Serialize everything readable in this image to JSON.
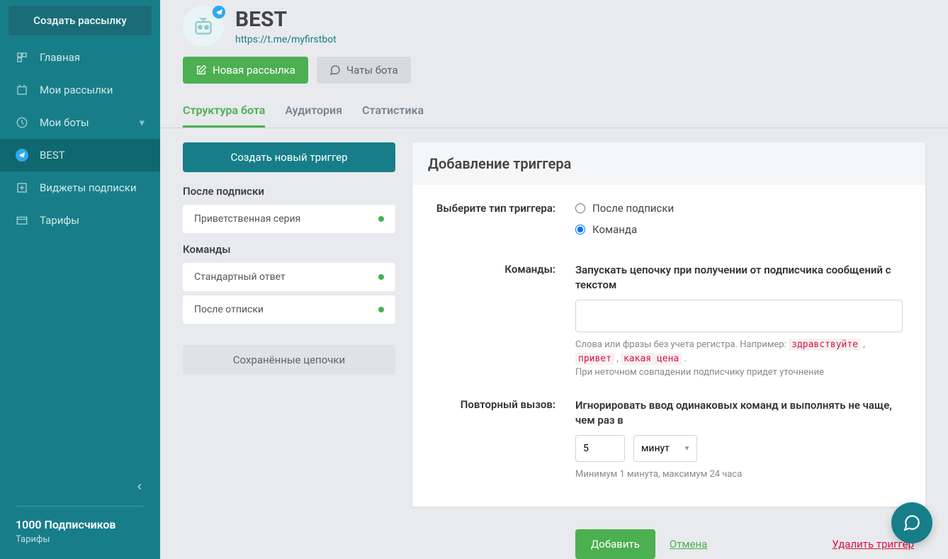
{
  "sidebar": {
    "create": "Создать рассылку",
    "items": [
      {
        "label": "Главная"
      },
      {
        "label": "Мои рассылки"
      },
      {
        "label": "Мои боты"
      },
      {
        "label": "BEST"
      },
      {
        "label": "Виджеты подписки"
      },
      {
        "label": "Тарифы"
      }
    ],
    "subscribers": "1000 Подписчиков",
    "tariff": "Тарифы"
  },
  "bot": {
    "name": "BEST",
    "link": "https://t.me/myfirstbot"
  },
  "buttons": {
    "new_broadcast": "Новая рассылка",
    "bot_chats": "Чаты бота"
  },
  "tabs": [
    "Структура бота",
    "Аудитория",
    "Статистика"
  ],
  "left": {
    "create_trigger": "Создать новый триггер",
    "after_sub": "После подписки",
    "triggers_sub": [
      {
        "label": "Приветственная серия"
      }
    ],
    "commands": "Команды",
    "triggers_cmd": [
      {
        "label": "Стандартный ответ"
      },
      {
        "label": "После отписки"
      }
    ],
    "saved": "Сохранённые цепочки"
  },
  "panel": {
    "title": "Добавление триггера",
    "type_label": "Выберите тип триггера:",
    "type_opt1": "После подписки",
    "type_opt2": "Команда",
    "cmd_label": "Команды:",
    "cmd_desc": "Запускать цепочку при получении от подписчика сообщений с текстом",
    "cmd_value": "",
    "help1": "Слова или фразы без учета регистра. Например: ",
    "ex1": "здравствуйте",
    "ex2": "привет",
    "ex3": "какая цена",
    "help2": "При неточном совпадении подписчику придет уточнение",
    "repeat_label": "Повторный вызов:",
    "repeat_desc": "Игнорировать ввод одинаковых команд и выполнять не чаще, чем раз в",
    "repeat_value": "5",
    "repeat_unit": "минут",
    "repeat_help": "Минимум 1 минута, максимум 24 часа",
    "add": "Добавить",
    "cancel": "Отмена",
    "delete": "Удалить триггер"
  }
}
